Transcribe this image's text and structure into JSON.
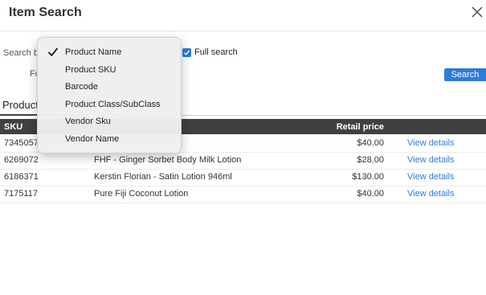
{
  "dialog": {
    "title": "Item Search"
  },
  "search": {
    "search_by_label": "Search b",
    "for_label": "Fo",
    "full_search_label": "Full search",
    "full_search_checked": true,
    "search_button_label": "Search"
  },
  "tabs": {
    "active_label": "Product"
  },
  "table": {
    "headers": {
      "sku": "SKU",
      "name": "",
      "price": "Retail price",
      "action": ""
    },
    "rows": [
      {
        "sku": "7345057",
        "name": "",
        "price": "$40.00",
        "action": "View details"
      },
      {
        "sku": "6269072",
        "name": "FHF - Ginger Sorbet Body Milk Lotion",
        "price": "$28.00",
        "action": "View details"
      },
      {
        "sku": "6186371",
        "name": "Kerstin Florian - Satin Lotion 946ml",
        "price": "$130.00",
        "action": "View details"
      },
      {
        "sku": "7175117",
        "name": "Pure Fiji Coconut Lotion",
        "price": "$40.00",
        "action": "View details"
      }
    ]
  },
  "dropdown": {
    "selected_index": 0,
    "options": [
      "Product Name",
      "Product SKU",
      "Barcode",
      "Product Class/SubClass",
      "Vendor Sku",
      "Vendor Name"
    ]
  },
  "colors": {
    "accent": "#2f7bd8",
    "header_bg": "#404040"
  },
  "icons": {
    "close": "close-icon",
    "check": "checkmark-icon"
  }
}
